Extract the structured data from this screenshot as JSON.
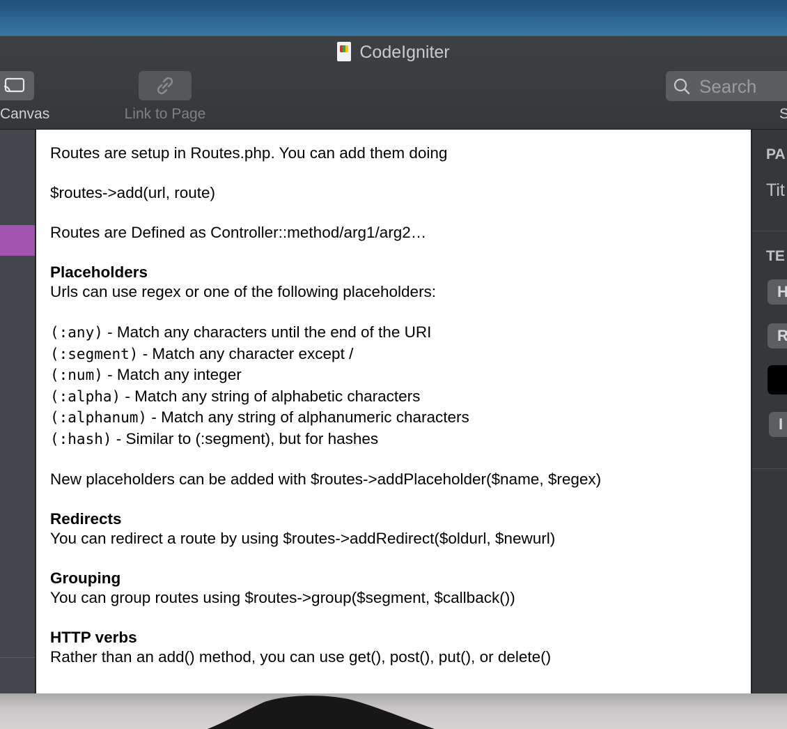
{
  "window": {
    "title": "CodeIgniter"
  },
  "toolbar": {
    "canvas_label": "Canvas",
    "link_label": "Link to Page",
    "search_placeholder": "Search",
    "search_partial_label": "S"
  },
  "inspector": {
    "section1_heading": "PA",
    "title_label": "Tit",
    "section2_heading": "TE",
    "button1": "H",
    "button2": "R",
    "button3": "I"
  },
  "note": {
    "intro": "Routes are setup in Routes.php. You can add them doing",
    "syntax": "$routes->add(url, route)",
    "definition": "Routes are Defined as Controller::method/arg1/arg2…",
    "placeholders_heading": "Placeholders",
    "placeholders_intro": "Urls can use regex or one of the following placeholders:",
    "placeholders": [
      {
        "code": "(:any)",
        "desc": " - Match any characters until the end of the URI"
      },
      {
        "code": "(:segment)",
        "desc": " - Match any character except /"
      },
      {
        "code": "(:num)",
        "desc": " - Match any integer"
      },
      {
        "code": "(:alpha)",
        "desc": " - Match any string of alphabetic characters"
      },
      {
        "code": "(:alphanum)",
        "desc": " - Match any string of alphanumeric characters"
      },
      {
        "code": "(:hash)",
        "desc": " - Similar to (:segment), but for hashes"
      }
    ],
    "new_placeholders": "New placeholders can be added with $routes->addPlaceholder($name, $regex)",
    "redirects_heading": "Redirects",
    "redirects_text": "You can redirect a route by using $routes->addRedirect($oldurl, $newurl)",
    "grouping_heading": "Grouping",
    "grouping_text": "You can group routes using $routes->group($segment, $callback())",
    "verbs_heading": "HTTP verbs",
    "verbs_text": "Rather than an add() method, you can use get(), post(), put(), or delete()"
  },
  "colors": {
    "selection": "#a354b0",
    "toolbar_bg": "#3e4144",
    "note_bg": "#ffffff"
  }
}
